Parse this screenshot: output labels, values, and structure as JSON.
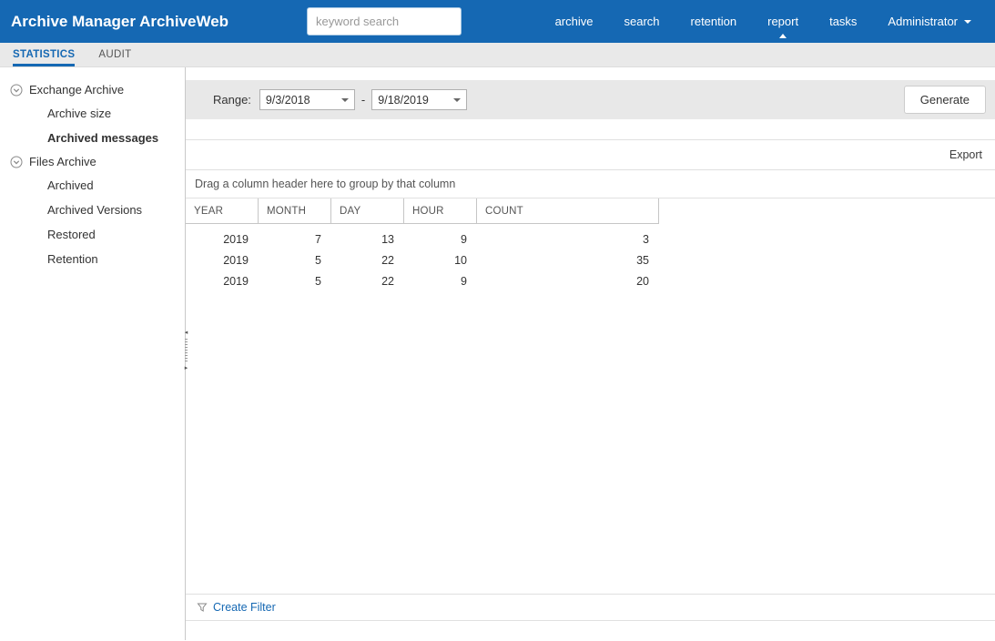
{
  "header": {
    "title": "Archive Manager ArchiveWeb",
    "search_placeholder": "keyword search",
    "nav": [
      {
        "label": "archive",
        "active": false
      },
      {
        "label": "search",
        "active": false
      },
      {
        "label": "retention",
        "active": false
      },
      {
        "label": "report",
        "active": true
      },
      {
        "label": "tasks",
        "active": false
      },
      {
        "label": "Administrator",
        "active": false,
        "has_dropdown": true
      }
    ]
  },
  "tabs": [
    {
      "label": "STATISTICS",
      "active": true
    },
    {
      "label": "AUDIT",
      "active": false
    }
  ],
  "sidebar": {
    "groups": [
      {
        "label": "Exchange Archive",
        "items": [
          {
            "label": "Archive size",
            "selected": false
          },
          {
            "label": "Archived messages",
            "selected": true
          }
        ]
      },
      {
        "label": "Files Archive",
        "items": [
          {
            "label": "Archived",
            "selected": false
          },
          {
            "label": "Archived Versions",
            "selected": false
          },
          {
            "label": "Restored",
            "selected": false
          },
          {
            "label": "Retention",
            "selected": false
          }
        ]
      }
    ]
  },
  "toolbar": {
    "range_label": "Range:",
    "date_from": "9/3/2018",
    "separator": "-",
    "date_to": "9/18/2019",
    "generate_label": "Generate"
  },
  "grid": {
    "export_label": "Export",
    "group_hint": "Drag a column header here to group by that column",
    "columns": [
      "YEAR",
      "MONTH",
      "DAY",
      "HOUR",
      "COUNT"
    ],
    "rows": [
      [
        "2019",
        "7",
        "13",
        "9",
        "3"
      ],
      [
        "2019",
        "5",
        "22",
        "10",
        "35"
      ],
      [
        "2019",
        "5",
        "22",
        "9",
        "20"
      ]
    ],
    "create_filter_label": "Create Filter"
  },
  "icons": {
    "group_toggle": "circled-chevron-down",
    "filter": "funnel",
    "report_active": "caret-up",
    "administrator": "caret-down",
    "date_dropdown": "caret-down",
    "splitter": "collapse-handle"
  },
  "colors": {
    "header_bg": "#1568b3",
    "accent": "#1568b3",
    "tabbar_bg": "#e9e9e9",
    "toolbar_bg": "#e8e8e8",
    "border": "#c9c9c9",
    "link": "#1568b3"
  }
}
